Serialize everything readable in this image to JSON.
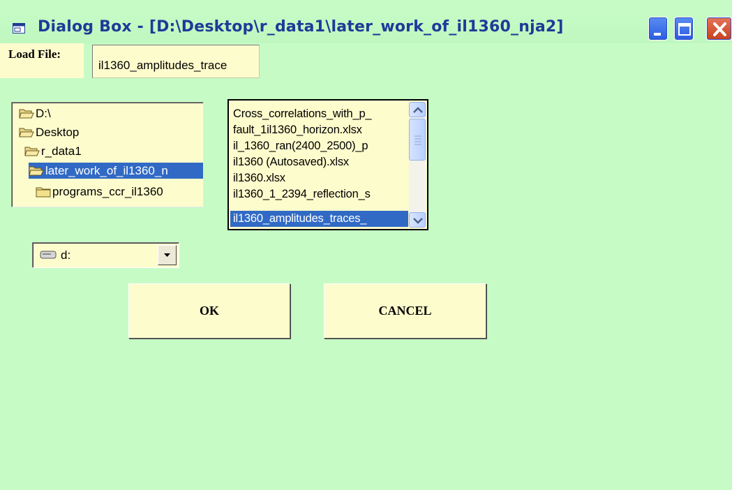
{
  "window": {
    "title": "Dialog Box - [D:\\Desktop\\r_data1\\later_work_of_il1360_nja2]",
    "icon": "window-icon",
    "controls": [
      "minimize",
      "maximize",
      "close"
    ]
  },
  "load_file": {
    "label": "Load File:",
    "value": "il1360_amplitudes_trace"
  },
  "directory_list": {
    "items": [
      {
        "label": "D:\\",
        "icon": "open-folder-icon",
        "selected": false
      },
      {
        "label": "Desktop",
        "icon": "open-folder-icon",
        "selected": false
      },
      {
        "label": "r_data1",
        "icon": "open-folder-icon",
        "selected": false
      },
      {
        "label": "later_work_of_il1360_n",
        "icon": "open-folder-icon",
        "selected": true
      },
      {
        "label": "programs_ccr_il1360",
        "icon": "closed-folder-icon",
        "selected": false
      }
    ]
  },
  "file_list": {
    "items": [
      {
        "label": "Cross_correlations_with_p_",
        "selected": false
      },
      {
        "label": "fault_1il1360_horizon.xlsx",
        "selected": false
      },
      {
        "label": "il_1360_ran(2400_2500)_p",
        "selected": false
      },
      {
        "label": "il1360 (Autosaved).xlsx",
        "selected": false
      },
      {
        "label": "il1360.xlsx",
        "selected": false
      },
      {
        "label": "il1360_1_2394_reflection_s",
        "selected": false
      },
      {
        "label": "il1360_amplitudes_traces_",
        "selected": true
      }
    ]
  },
  "drive_select": {
    "value": "d:",
    "icon": "drive-icon"
  },
  "buttons": {
    "ok": "OK",
    "cancel": "CANCEL"
  },
  "colors": {
    "background": "#c6fbc6",
    "field": "#fdfccd",
    "selection": "#316ac5",
    "title_text": "#1f3a98"
  }
}
